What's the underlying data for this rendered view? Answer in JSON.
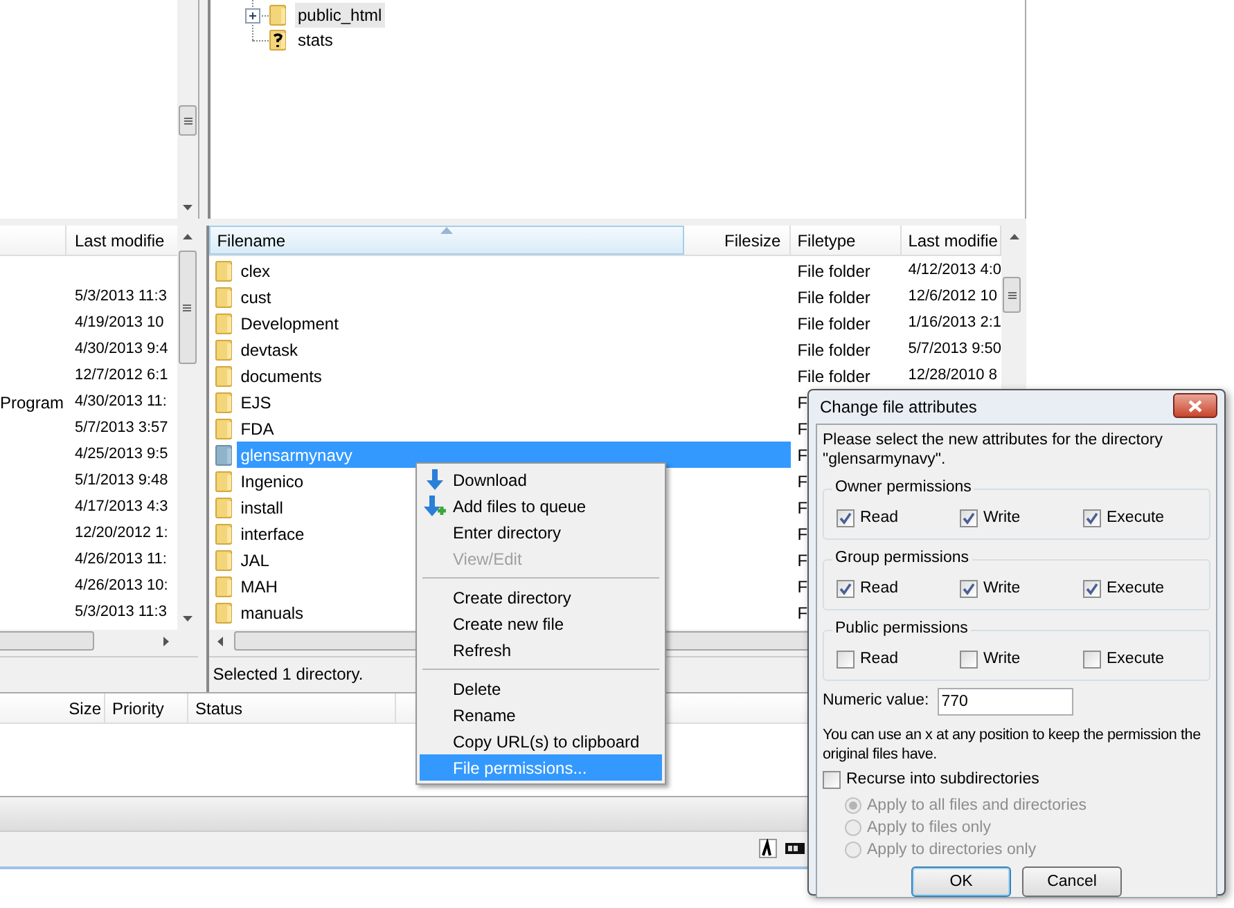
{
  "remote_tree": {
    "items": [
      {
        "name": "public_html",
        "kind": "folder",
        "expandable": true,
        "selected": true
      },
      {
        "name": "stats",
        "kind": "unknown",
        "expandable": false,
        "selected": false
      }
    ]
  },
  "local_list": {
    "columns": [
      "Last modifie"
    ],
    "rows": [
      {
        "last_modified": "5/3/2013 11:3"
      },
      {
        "last_modified": "4/19/2013 10"
      },
      {
        "last_modified": "4/30/2013 9:4"
      },
      {
        "last_modified": "12/7/2012 6:1"
      },
      {
        "column_1": "Program",
        "last_modified": "4/30/2013 11:"
      },
      {
        "last_modified": "5/7/2013 3:57"
      },
      {
        "last_modified": "4/25/2013 9:5"
      },
      {
        "last_modified": "5/1/2013 9:48"
      },
      {
        "last_modified": "4/17/2013 4:3"
      },
      {
        "last_modified": "12/20/2012 1:"
      },
      {
        "last_modified": "4/26/2013 11:"
      },
      {
        "last_modified": "4/26/2013 10:"
      },
      {
        "last_modified": "5/3/2013 11:3"
      }
    ]
  },
  "remote_list": {
    "columns": [
      "Filename",
      "Filesize",
      "Filetype",
      "Last modifie"
    ],
    "rows": [
      {
        "name": "clex",
        "type": "File folder",
        "modified": "4/12/2013 4:0",
        "selected": false
      },
      {
        "name": "cust",
        "type": "File folder",
        "modified": "12/6/2012 10",
        "selected": false
      },
      {
        "name": "Development",
        "type": "File folder",
        "modified": "1/16/2013 2:1",
        "selected": false
      },
      {
        "name": "devtask",
        "type": "File folder",
        "modified": "5/7/2013 9:50",
        "selected": false
      },
      {
        "name": "documents",
        "type": "File folder",
        "modified": "12/28/2010 8",
        "selected": false
      },
      {
        "name": "EJS",
        "type": "F",
        "selected": false
      },
      {
        "name": "FDA",
        "type": "F",
        "selected": false
      },
      {
        "name": "glensarmynavy",
        "type": "F",
        "selected": true
      },
      {
        "name": "Ingenico",
        "type": "F",
        "selected": false
      },
      {
        "name": "install",
        "type": "F",
        "selected": false
      },
      {
        "name": "interface",
        "type": "F",
        "selected": false
      },
      {
        "name": "JAL",
        "type": "F",
        "selected": false
      },
      {
        "name": "MAH",
        "type": "F",
        "selected": false
      },
      {
        "name": "manuals",
        "type": "F",
        "selected": false
      }
    ],
    "status": "Selected 1 directory."
  },
  "queue": {
    "columns": [
      "Size",
      "Priority",
      "Status"
    ]
  },
  "context_menu": {
    "items": [
      {
        "kind": "download",
        "label": "Download",
        "disabled": false,
        "selected": false
      },
      {
        "kind": "queue",
        "label": "Add files to queue",
        "disabled": false,
        "selected": false
      },
      {
        "kind": "item",
        "label": "Enter directory",
        "disabled": false,
        "selected": false
      },
      {
        "kind": "item",
        "label": "View/Edit",
        "disabled": true,
        "selected": false
      },
      {
        "kind": "separator"
      },
      {
        "kind": "item",
        "label": "Create directory",
        "disabled": false,
        "selected": false
      },
      {
        "kind": "item",
        "label": "Create new file",
        "disabled": false,
        "selected": false
      },
      {
        "kind": "item",
        "label": "Refresh",
        "disabled": false,
        "selected": false
      },
      {
        "kind": "separator"
      },
      {
        "kind": "item",
        "label": "Delete",
        "disabled": false,
        "selected": false
      },
      {
        "kind": "item",
        "label": "Rename",
        "disabled": false,
        "selected": false
      },
      {
        "kind": "item",
        "label": "Copy URL(s) to clipboard",
        "disabled": false,
        "selected": false
      },
      {
        "kind": "item",
        "label": "File permissions...",
        "disabled": false,
        "selected": true
      }
    ]
  },
  "dialog": {
    "title": "Change file attributes",
    "description": "Please select the new attributes for the directory \"glensarmynavy\".",
    "groups": [
      {
        "title": "Owner permissions",
        "options": [
          {
            "label": "Read",
            "checked": true
          },
          {
            "label": "Write",
            "checked": true
          },
          {
            "label": "Execute",
            "checked": true
          }
        ]
      },
      {
        "title": "Group permissions",
        "options": [
          {
            "label": "Read",
            "checked": true
          },
          {
            "label": "Write",
            "checked": true
          },
          {
            "label": "Execute",
            "checked": true
          }
        ]
      },
      {
        "title": "Public permissions",
        "options": [
          {
            "label": "Read",
            "checked": false
          },
          {
            "label": "Write",
            "checked": false
          },
          {
            "label": "Execute",
            "checked": false
          }
        ]
      }
    ],
    "numeric_label": "Numeric value:",
    "numeric_value": "770",
    "note": "You can use an x at any position to keep the permission the original files have.",
    "recurse": {
      "label": "Recurse into subdirectories",
      "checked": false
    },
    "apply_options": [
      {
        "label": "Apply to all files and directories",
        "selected": true,
        "disabled": true
      },
      {
        "label": "Apply to files only",
        "selected": false,
        "disabled": true
      },
      {
        "label": "Apply to directories only",
        "selected": false,
        "disabled": true
      }
    ],
    "buttons": [
      {
        "label": "OK",
        "default": true
      },
      {
        "label": "Cancel",
        "default": false
      }
    ]
  }
}
